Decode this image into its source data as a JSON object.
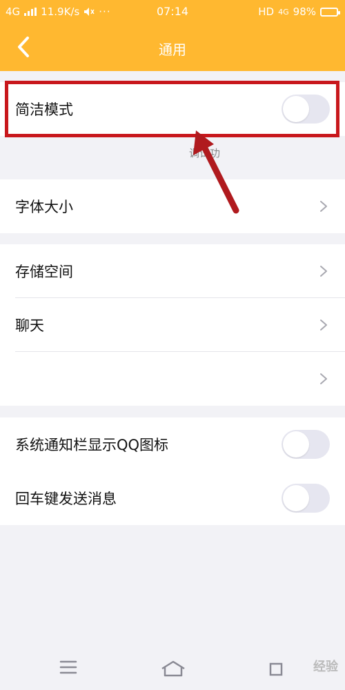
{
  "colors": {
    "header": "#ffb830",
    "highlight": "#c8171c",
    "background": "#f2f2f6"
  },
  "status": {
    "network": "4G",
    "speed": "11.9K/s",
    "time": "07:14",
    "hd": "HD",
    "network_right": "4G",
    "battery": "98%",
    "battery_level": 0.98
  },
  "header": {
    "title": "通用",
    "back_icon": "chevron-left-icon"
  },
  "sections": {
    "simple_mode": {
      "label": "简洁模式",
      "enabled": false
    },
    "caption": "调试功",
    "font_size": {
      "label": "字体大小"
    },
    "storage": {
      "label": "存储空间"
    },
    "chat": {
      "label": "聊天"
    },
    "blank": {
      "label": ""
    },
    "notify_icon": {
      "label": "系统通知栏显示QQ图标",
      "enabled": false
    },
    "enter_send": {
      "label": "回车键发送消息",
      "enabled": false
    }
  },
  "bottom_nav": {
    "menu_icon": "menu-icon",
    "home_icon": "home-icon",
    "back_icon": "back-icon"
  },
  "watermark": "经验"
}
